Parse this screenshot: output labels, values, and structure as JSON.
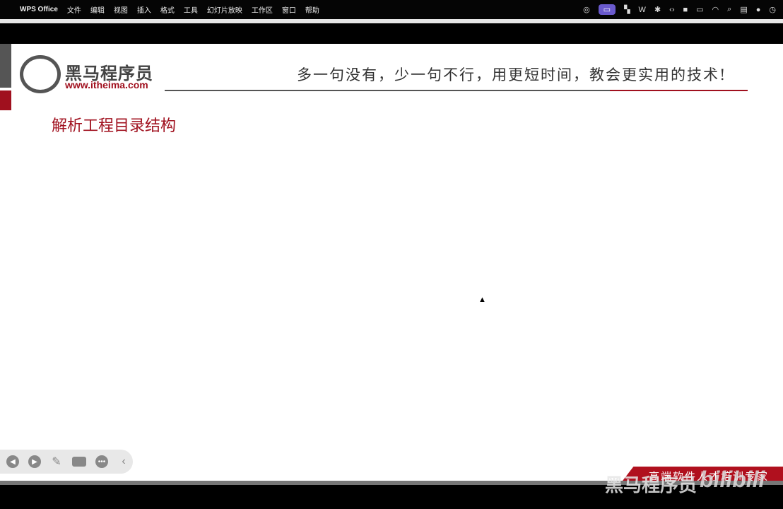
{
  "menubar": {
    "app": "WPS Office",
    "items": [
      "文件",
      "编辑",
      "视图",
      "插入",
      "格式",
      "工具",
      "幻灯片放映",
      "工作区",
      "窗口",
      "帮助"
    ]
  },
  "slide": {
    "brand": "黑马程序员",
    "url": "www.itheima.com",
    "slogan": "多一句没有，少一句不行，用更短时间，教会更实用的技术!",
    "title": "解析工程目录结构",
    "footer": "高端软件人才培训专家"
  },
  "watermark": {
    "brand": "黑马程序员",
    "site": "bilibili"
  },
  "colors": {
    "accent": "#a0101e"
  }
}
